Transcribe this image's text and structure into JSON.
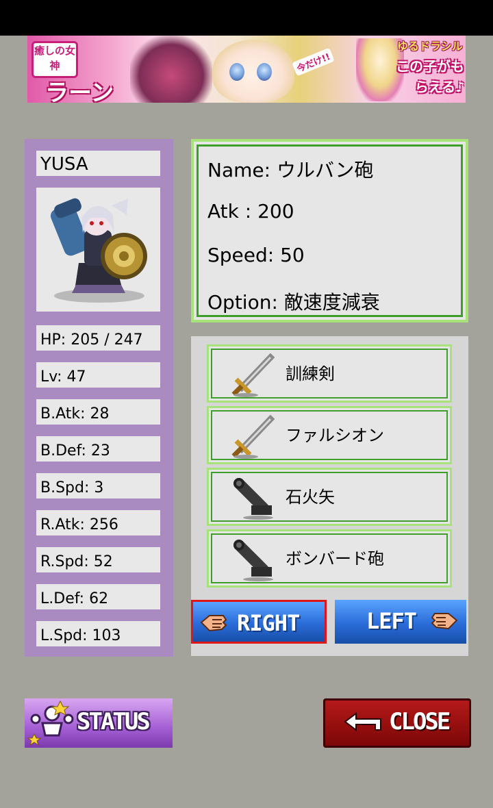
{
  "banner": {
    "left_tag": "癒しの女神",
    "left_title": "ラーン",
    "mid_tag": "今だけ!!",
    "brand": "ゆるドラシル",
    "promo": "この子がもらえる♪"
  },
  "character": {
    "name": "YUSA",
    "stats": [
      "HP: 205 / 247",
      "Lv: 47",
      "B.Atk: 28",
      "B.Def: 23",
      "B.Spd: 3",
      "R.Atk: 256",
      "R.Spd: 52",
      "L.Def: 62",
      "L.Spd: 103"
    ]
  },
  "selected_weapon": {
    "name": "Name: ウルバン砲",
    "atk": "Atk : 200",
    "speed": "Speed: 50",
    "option": "Option: 敵速度減衰"
  },
  "weapons": [
    {
      "name": "訓練剣",
      "icon": "sword-icon"
    },
    {
      "name": "ファルシオン",
      "icon": "sword-icon"
    },
    {
      "name": "石火矢",
      "icon": "cannon-icon"
    },
    {
      "name": "ボンバード砲",
      "icon": "cannon-icon"
    }
  ],
  "buttons": {
    "right": "RIGHT",
    "left": "LEFT",
    "status": "STATUS",
    "close": "CLOSE"
  },
  "colors": {
    "background": "#a3a39c",
    "left_panel": "#a98bc1",
    "frame_light_green": "#a8e27b",
    "frame_dark_green": "#3f9d2c",
    "blue_button": "#2a6cd8",
    "selected_outline": "#e01616",
    "status_purple": "#a45fd4",
    "close_red": "#9a0f0f"
  }
}
